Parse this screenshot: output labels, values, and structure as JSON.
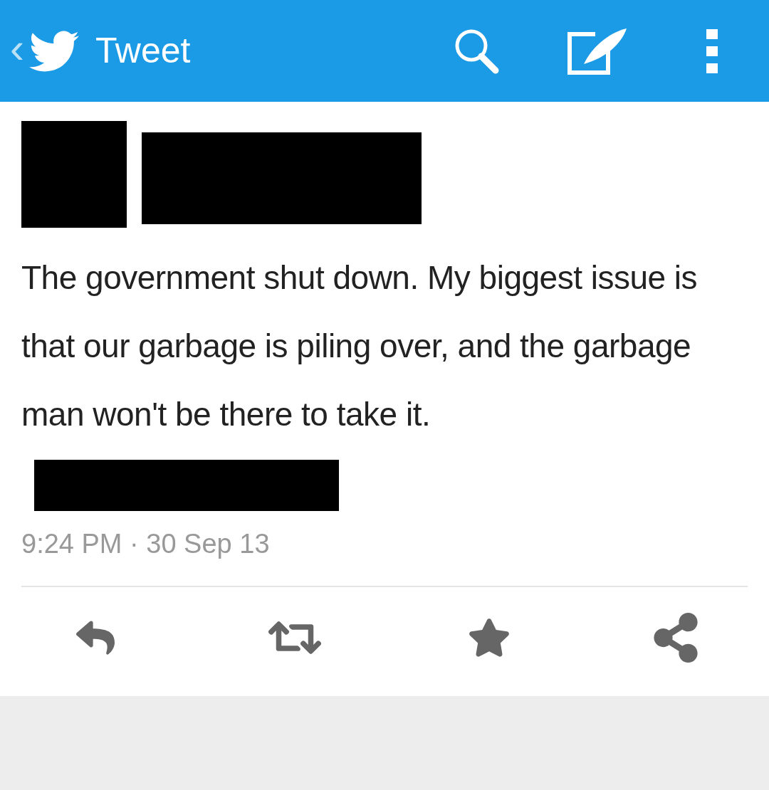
{
  "header": {
    "back": "‹",
    "title": "Tweet"
  },
  "tweet": {
    "text": "The government shut down. My biggest issue is that our garbage is piling over, and the garbage man won't be there to take it.",
    "timestamp": "9:24 PM · 30 Sep 13"
  }
}
